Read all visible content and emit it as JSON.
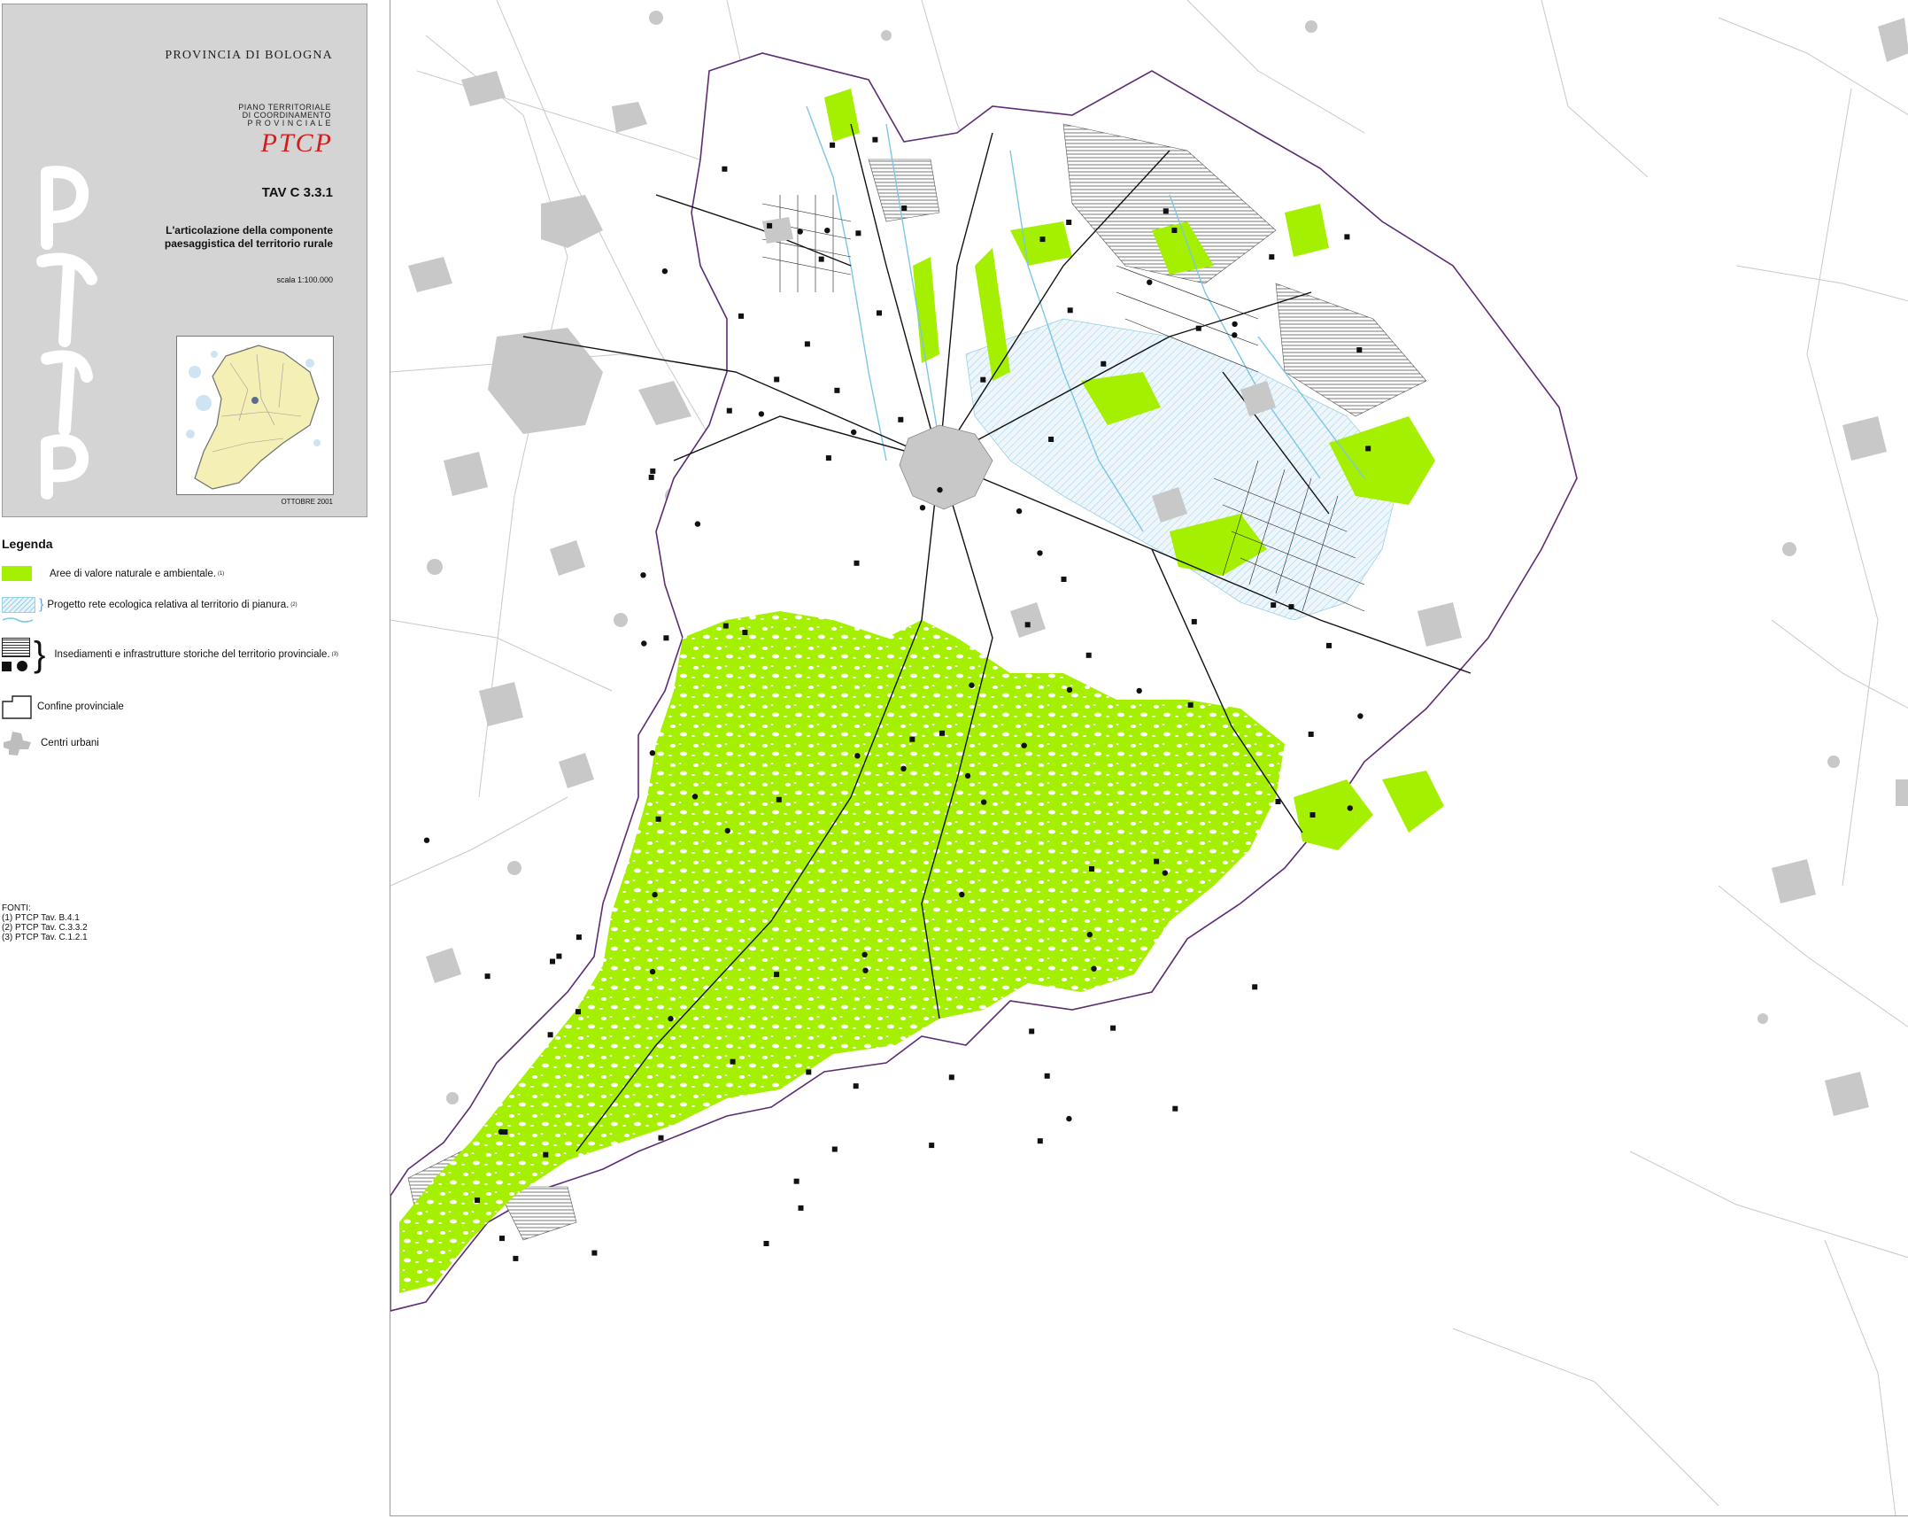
{
  "card": {
    "province": "PROVINCIA DI BOLOGNA",
    "plan_lines": [
      "PIANO TERRITORIALE",
      "DI COORDINAMENTO",
      "P R O V I N C I A L E"
    ],
    "plan_logo": "PTCP",
    "tav": "TAV C 3.3.1",
    "subtitle_line1": "L'articolazione della componente",
    "subtitle_line2": "paesaggistica del territorio rurale",
    "scale": "scala 1:100.000",
    "date": "OTTOBRE 2001"
  },
  "legend": {
    "title": "Legenda",
    "items": [
      {
        "label": "Aree di valore naturale e ambientale.",
        "note": "(1)"
      },
      {
        "label": "Progetto rete ecologica relativa al territorio di pianura.",
        "note": "(2)"
      },
      {
        "label": "Insediamenti e infrastrutture storiche del territorio provinciale.",
        "note": "(3)"
      },
      {
        "label": "Confine provinciale",
        "note": ""
      },
      {
        "label": "Centri urbani",
        "note": ""
      }
    ]
  },
  "sources": {
    "title": "FONTI:",
    "lines": [
      "(1) PTCP Tav. B.4.1",
      "(2) PTCP Tav. C.3.3.2",
      "(3) PTCP Tav. C.1.2.1"
    ]
  },
  "colors": {
    "natural_area": "#a5ef00",
    "urban": "#c8c8c8",
    "ecological_network": "#9ad0e6",
    "boundary": "#5b2d73",
    "historic": "#111111",
    "card_bg": "#d4d4d4",
    "logo_red": "#d21d1d"
  },
  "icons": {
    "square_marker": "filled-square",
    "circle_marker": "filled-circle"
  }
}
